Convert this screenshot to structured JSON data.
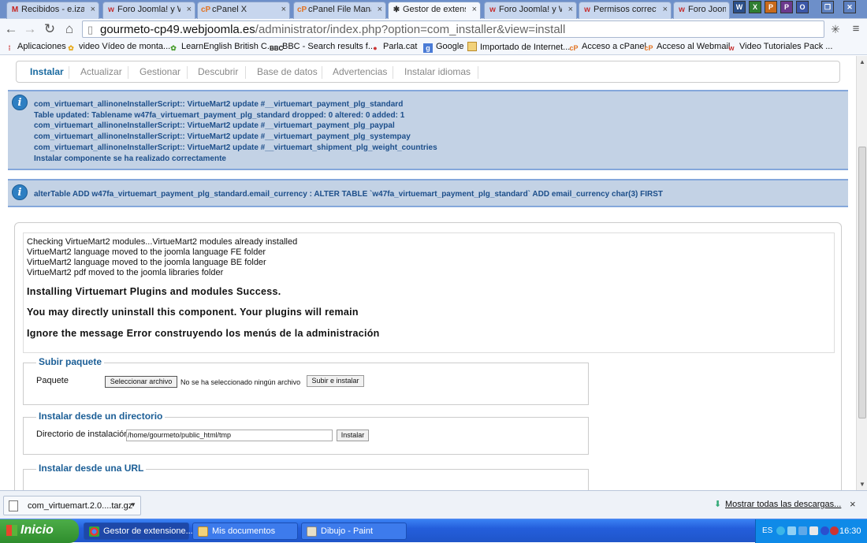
{
  "browser": {
    "tabs": [
      {
        "label": "Recibidos - e.izag",
        "icon": "gmail-icon"
      },
      {
        "label": "Foro Joomla! y W",
        "icon": "joomla-icon"
      },
      {
        "label": "cPanel X",
        "icon": "cpanel-icon"
      },
      {
        "label": "cPanel File Manag",
        "icon": "cpanel-icon"
      },
      {
        "label": "Gestor de extensi",
        "icon": "joomla-icon",
        "active": true
      },
      {
        "label": "Foro Joomla! y W",
        "icon": "joomla-icon"
      },
      {
        "label": "Permisos correcto",
        "icon": "joomla-icon"
      },
      {
        "label": "Foro Joom",
        "icon": "joomla-icon"
      }
    ],
    "url_host": "gourmeto-cp49.webjoomla.es",
    "url_path": "/administrator/index.php?option=com_installer&view=install",
    "bookmarks": [
      {
        "label": "Aplicaciones",
        "icon": "apps-grid-icon"
      },
      {
        "label": "video Vídeo de monta...",
        "icon": "video-icon"
      },
      {
        "label": "LearnEnglish  British C...",
        "icon": "learnenglish-icon"
      },
      {
        "label": "BBC - Search results f...",
        "icon": "bbc-icon"
      },
      {
        "label": "Parla.cat",
        "icon": "parla-icon"
      },
      {
        "label": "Google",
        "icon": "google-icon"
      },
      {
        "label": "Importado de Internet...",
        "icon": "folder-icon"
      },
      {
        "label": "Acceso a cPanel",
        "icon": "cpanel-icon"
      },
      {
        "label": "Acceso al Webmail",
        "icon": "cpanel-icon"
      },
      {
        "label": "Video Tutoriales Pack ...",
        "icon": "video-icon"
      }
    ]
  },
  "subnav": {
    "tabs": [
      "Instalar",
      "Actualizar",
      "Gestionar",
      "Descubrir",
      "Base de datos",
      "Advertencias",
      "Instalar idiomas"
    ],
    "active": "Instalar"
  },
  "messages": {
    "first": [
      "com_virtuemart_allinoneInstallerScript:: VirtueMart2 update #__virtuemart_payment_plg_standard",
      "Table updated: Tablename w47fa_virtuemart_payment_plg_standard dropped: 0 altered: 0 added: 1",
      "com_virtuemart_allinoneInstallerScript:: VirtueMart2 update #__virtuemart_payment_plg_paypal",
      "com_virtuemart_allinoneInstallerScript:: VirtueMart2 update #__virtuemart_payment_plg_systempay",
      "com_virtuemart_allinoneInstallerScript:: VirtueMart2 update #__virtuemart_shipment_plg_weight_countries",
      "Instalar componente se ha realizado correctamente"
    ],
    "second": "alterTable ADD w47fa_virtuemart_payment_plg_standard.email_currency : ALTER TABLE `w47fa_virtuemart_payment_plg_standard` ADD email_currency char(3) FIRST"
  },
  "log": {
    "lines": [
      "Checking VirtueMart2 modules...VirtueMart2 modules already installed",
      "VirtueMart2 language moved to the joomla language FE folder",
      "VirtueMart2 language moved to the joomla language BE folder",
      "VirtueMart2 pdf moved to the joomla libraries folder"
    ],
    "bold": [
      "Installing Virtuemart Plugins and modules Success.",
      "You may directly uninstall this component. Your plugins will remain",
      "Ignore the message Error construyendo los menús de la administración"
    ]
  },
  "upload": {
    "legend": "Subir paquete",
    "label": "Paquete",
    "choose_button": "Seleccionar archivo",
    "no_file": "No se ha seleccionado ningún archivo",
    "submit_button": "Subir e instalar"
  },
  "directory": {
    "legend": "Instalar desde un directorio",
    "label": "Directorio de instalación",
    "value": "/home/gourmeto/public_html/tmp",
    "submit_button": "Instalar"
  },
  "url_install": {
    "legend": "Instalar desde una URL"
  },
  "downloads": {
    "file": "com_virtuemart.2.0....tar.gz",
    "show_all": "Mostrar todas las descargas...",
    "close": "×"
  },
  "taskbar": {
    "start": "Inicio",
    "tasks": [
      {
        "label": "Gestor de extensione...",
        "icon": "chrome-icon"
      },
      {
        "label": "Mis documentos",
        "icon": "folder-icon"
      },
      {
        "label": "Dibujo - Paint",
        "icon": "paint-icon"
      }
    ],
    "lang": "ES",
    "clock": "16:30"
  },
  "colors": {
    "message_bg": "#c3d2e5",
    "message_text": "#1c4e8a",
    "legend_text": "#1b5e96",
    "active_subtab": "#1a6aa0",
    "taskbar": "#245edb"
  }
}
